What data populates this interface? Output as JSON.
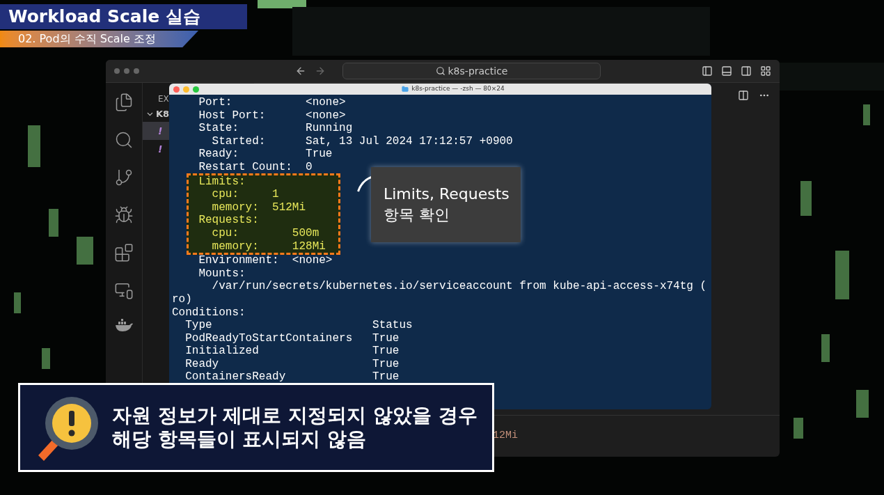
{
  "banner": {
    "title": "Workload Scale 실습",
    "subtitle": "02. Pod의 수직 Scale 조정"
  },
  "vscode": {
    "search": "k8s-practice",
    "explorer_header": "EX",
    "folder": "K8",
    "files": [
      {
        "icon": "!",
        "selected": true
      },
      {
        "icon": "!",
        "selected": false
      }
    ],
    "panel_text": "12Mi"
  },
  "terminal": {
    "title": "k8s-practice — -zsh — 80×24",
    "lines": [
      {
        "text": "    Port:           <none>",
        "highlight": false
      },
      {
        "text": "    Host Port:      <none>",
        "highlight": false
      },
      {
        "text": "    State:          Running",
        "highlight": false
      },
      {
        "text": "      Started:      Sat, 13 Jul 2024 17:12:57 +0900",
        "highlight": false
      },
      {
        "text": "    Ready:          True",
        "highlight": false
      },
      {
        "text": "    Restart Count:  0",
        "highlight": false
      },
      {
        "text": "    Limits:",
        "highlight": true
      },
      {
        "text": "      cpu:     1",
        "highlight": true
      },
      {
        "text": "      memory:  512Mi",
        "highlight": true
      },
      {
        "text": "    Requests:",
        "highlight": true
      },
      {
        "text": "      cpu:        500m",
        "highlight": true
      },
      {
        "text": "      memory:     128Mi",
        "highlight": true
      },
      {
        "text": "    Environment:  <none>",
        "highlight": false
      },
      {
        "text": "    Mounts:",
        "highlight": false
      },
      {
        "text": "      /var/run/secrets/kubernetes.io/serviceaccount from kube-api-access-x74tg (",
        "highlight": false
      },
      {
        "text": "ro)",
        "highlight": false
      },
      {
        "text": "Conditions:",
        "highlight": false
      },
      {
        "text": "  Type                        Status",
        "highlight": false
      },
      {
        "text": "  PodReadyToStartContainers   True",
        "highlight": false
      },
      {
        "text": "  Initialized                 True",
        "highlight": false
      },
      {
        "text": "  Ready                       True",
        "highlight": false
      },
      {
        "text": "  ContainersReady             True",
        "highlight": false
      }
    ]
  },
  "callout": {
    "lines": [
      "Limits, Requests",
      "항목 확인"
    ]
  },
  "caption": {
    "lines": [
      "자원 정보가 제대로 지정되지 않았을 경우",
      "해당 항목들이 표시되지 않음"
    ]
  }
}
